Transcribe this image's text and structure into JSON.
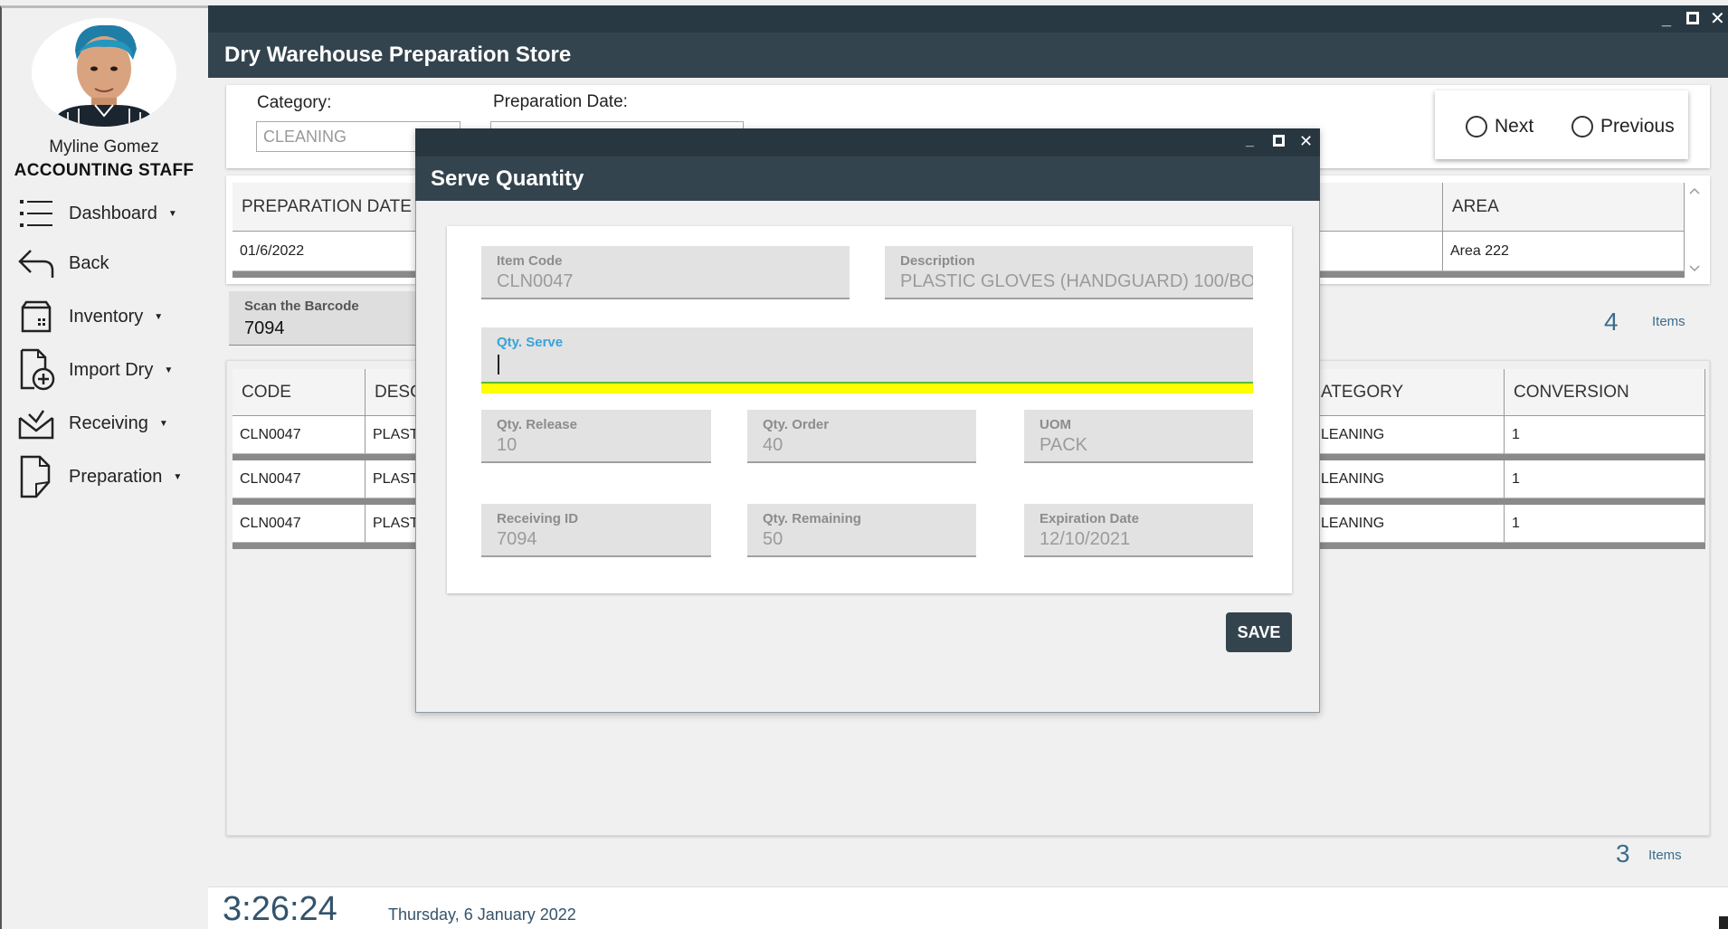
{
  "window": {
    "title": "Dry Warehouse Preparation Store"
  },
  "user": {
    "name": "Myline Gomez",
    "role": "ACCOUNTING STAFF"
  },
  "sidebar": {
    "items": [
      {
        "label": "Dashboard",
        "icon": "list-icon",
        "dropdown": true
      },
      {
        "label": "Back",
        "icon": "back-arrow-icon",
        "dropdown": false
      },
      {
        "label": "Inventory",
        "icon": "inventory-box-icon",
        "dropdown": true
      },
      {
        "label": "Import Dry",
        "icon": "add-document-icon",
        "dropdown": true
      },
      {
        "label": "Receiving",
        "icon": "inbox-envelope-icon",
        "dropdown": true
      },
      {
        "label": "Preparation",
        "icon": "document-icon",
        "dropdown": true
      }
    ]
  },
  "filters": {
    "category_label": "Category:",
    "category_value": "CLEANING",
    "prep_date_label": "Preparation Date:",
    "prep_date_value": ""
  },
  "navigation": {
    "next_label": "Next",
    "previous_label": "Previous",
    "selected": null
  },
  "top_grid": {
    "columns": [
      "PREPARATION DATE",
      "AREA"
    ],
    "rows": [
      {
        "prep_date": "01/6/2022",
        "area": "Area 222"
      }
    ]
  },
  "barcode": {
    "label": "Scan the Barcode",
    "value": "7094"
  },
  "top_count": {
    "value": "4",
    "label": "Items"
  },
  "bottom_grid": {
    "columns": [
      "CODE",
      "DESC",
      "ATEGORY",
      "CONVERSION"
    ],
    "rows": [
      {
        "code": "CLN0047",
        "desc": "PLASTI(",
        "category": "LEANING",
        "conversion": "1"
      },
      {
        "code": "CLN0047",
        "desc": "PLASTI(",
        "category": "LEANING",
        "conversion": "1"
      },
      {
        "code": "CLN0047",
        "desc": "PLASTI(",
        "category": "LEANING",
        "conversion": "1"
      }
    ]
  },
  "bottom_count": {
    "value": "3",
    "label": "Items"
  },
  "footer": {
    "time": "3:26:24",
    "date": "Thursday, 6 January 2022"
  },
  "modal": {
    "title": "Serve Quantity",
    "item_code": {
      "label": "Item Code",
      "value": "CLN0047"
    },
    "description": {
      "label": "Description",
      "value": "PLASTIC GLOVES (HANDGUARD) 100/BO"
    },
    "qty_serve": {
      "label": "Qty. Serve",
      "value": ""
    },
    "qty_release": {
      "label": "Qty. Release",
      "value": "10"
    },
    "qty_order": {
      "label": "Qty. Order",
      "value": "40"
    },
    "uom": {
      "label": "UOM",
      "value": "PACK"
    },
    "receiving_id": {
      "label": "Receiving ID",
      "value": "7094"
    },
    "qty_remaining": {
      "label": "Qty. Remaining",
      "value": "50"
    },
    "expiration_date": {
      "label": "Expiration Date",
      "value": "12/10/2021"
    },
    "save_label": "SAVE"
  },
  "colors": {
    "header_dark": "#27363f",
    "header": "#34444e",
    "accent_blue": "#38a3d9",
    "focus_yellow": "#ffff00",
    "count_blue": "#3b6c8c"
  }
}
